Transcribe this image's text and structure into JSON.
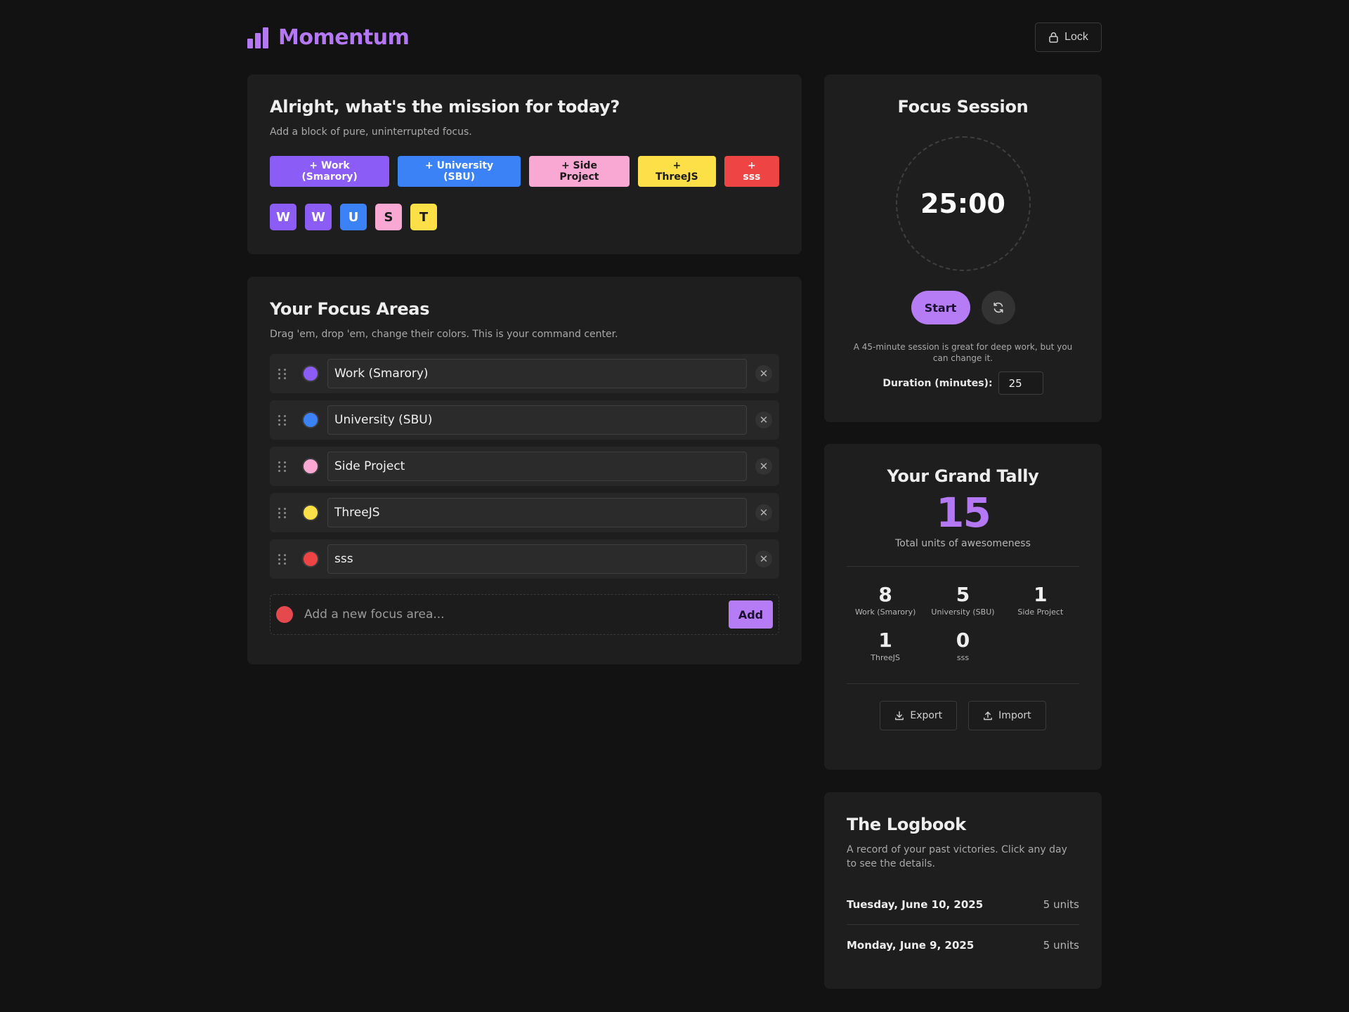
{
  "app": {
    "title": "Momentum",
    "lock_label": "Lock"
  },
  "mission": {
    "title": "Alright, what's the mission for today?",
    "subtitle": "Add a block of pure, uninterrupted focus.",
    "quick_buttons": [
      {
        "label": "+ Work (Smarory)",
        "bg": "#8b5cf6",
        "fg": "#ffffff"
      },
      {
        "label": "+ University (SBU)",
        "bg": "#3b82f6",
        "fg": "#ffffff"
      },
      {
        "label": "+ Side Project",
        "bg": "#f9a8d4",
        "fg": "#1a1a1a"
      },
      {
        "label": "+ ThreeJS",
        "bg": "#fde047",
        "fg": "#1a1a1a"
      },
      {
        "label": "+ sss",
        "bg": "#ef4444",
        "fg": "#ffffff"
      }
    ],
    "chips": [
      {
        "letter": "W",
        "bg": "#8b5cf6",
        "fg": "#ffffff"
      },
      {
        "letter": "W",
        "bg": "#8b5cf6",
        "fg": "#ffffff"
      },
      {
        "letter": "U",
        "bg": "#3b82f6",
        "fg": "#ffffff"
      },
      {
        "letter": "S",
        "bg": "#f9a8d4",
        "fg": "#1a1a1a"
      },
      {
        "letter": "T",
        "bg": "#fde047",
        "fg": "#1a1a1a"
      }
    ]
  },
  "areas": {
    "title": "Your Focus Areas",
    "subtitle": "Drag 'em, drop 'em, change their colors. This is your command center.",
    "items": [
      {
        "name": "Work (Smarory)",
        "color": "#8b5cf6"
      },
      {
        "name": "University (SBU)",
        "color": "#3b82f6"
      },
      {
        "name": "Side Project",
        "color": "#f9a8d4"
      },
      {
        "name": "ThreeJS",
        "color": "#fde047"
      },
      {
        "name": "sss",
        "color": "#ef4444"
      }
    ],
    "new_placeholder": "Add a new focus area...",
    "new_color": "#e5484d",
    "add_label": "Add"
  },
  "session": {
    "title": "Focus Session",
    "timer": "25:00",
    "start_label": "Start",
    "note": "A 45-minute session is great for deep work, but you can change it.",
    "duration_label": "Duration (minutes):",
    "duration_value": "25"
  },
  "tally": {
    "title": "Your Grand Tally",
    "total": "15",
    "caption": "Total units of awesomeness",
    "items": [
      {
        "count": "8",
        "name": "Work (Smarory)"
      },
      {
        "count": "5",
        "name": "University (SBU)"
      },
      {
        "count": "1",
        "name": "Side Project"
      },
      {
        "count": "1",
        "name": "ThreeJS"
      },
      {
        "count": "0",
        "name": "sss"
      }
    ],
    "export_label": "Export",
    "import_label": "Import"
  },
  "logbook": {
    "title": "The Logbook",
    "subtitle": "A record of your past victories. Click any day to see the details.",
    "entries": [
      {
        "date": "Tuesday, June 10, 2025",
        "units": "5 units"
      },
      {
        "date": "Monday, June 9, 2025",
        "units": "5 units"
      }
    ]
  },
  "colors": {
    "accent": "#b578f5",
    "background": "#121212",
    "card": "#1e1e1e"
  },
  "icons": [
    "bar-chart-icon",
    "lock-icon",
    "drag-handle-icon",
    "close-icon",
    "refresh-icon",
    "download-icon",
    "upload-icon"
  ]
}
